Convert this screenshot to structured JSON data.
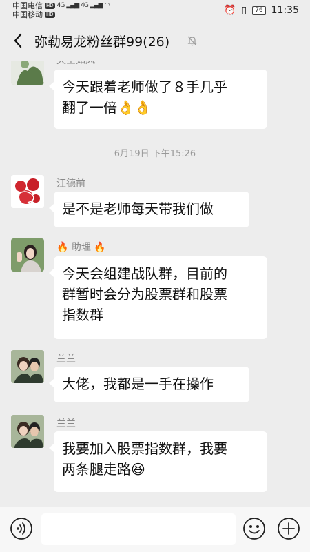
{
  "status_bar": {
    "carrier1": "中国电信",
    "carrier2": "中国移动",
    "hd": "HD",
    "net1": "4G",
    "net2": "4G",
    "battery": "76",
    "time": "11:35"
  },
  "header": {
    "title": "弥勒易龙粉丝群99(26)"
  },
  "messages": [
    {
      "sender": "天空如风",
      "lines": [
        "今天跟着老师做了８手几乎",
        "翻了一倍"
      ],
      "emoji": "👌👌"
    },
    {
      "timestamp": "6月19日 下午15:26"
    },
    {
      "sender": "汪德前",
      "lines": [
        "是不是老师每天带我们做"
      ]
    },
    {
      "sender": "助理",
      "sender_emoji": "🔥",
      "lines": [
        "今天会组建战队群，目前的",
        "群暂时会分为股票群和股票",
        "指数群"
      ]
    },
    {
      "sender": "兰兰",
      "lines": [
        "大佬，我都是一手在操作"
      ]
    },
    {
      "sender": "兰兰",
      "lines": [
        "我要加入股票指数群，我要",
        "两条腿走路"
      ],
      "emoji": "😆"
    }
  ],
  "icons": {
    "back": "chevron-left-icon",
    "mute": "bell-off-icon",
    "voice": "voice-icon",
    "emoji": "emoji-icon",
    "plus": "plus-icon"
  }
}
